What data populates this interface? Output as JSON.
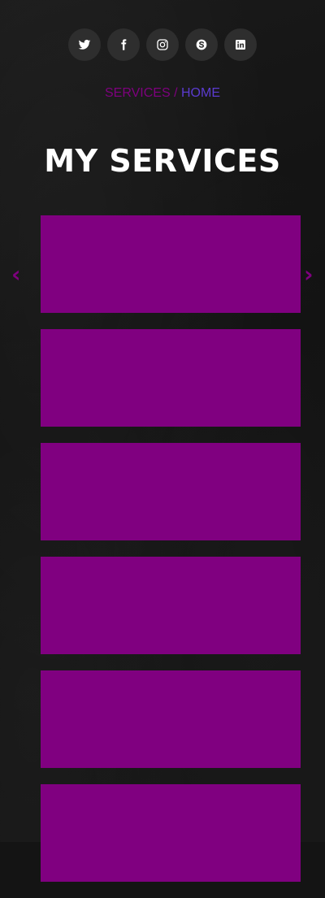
{
  "social": [
    {
      "name": "twitter-icon"
    },
    {
      "name": "facebook-icon"
    },
    {
      "name": "instagram-icon"
    },
    {
      "name": "skype-icon"
    },
    {
      "name": "linkedin-icon"
    }
  ],
  "breadcrumb": {
    "current": "SERVICES",
    "separator": "/",
    "home": "HOME"
  },
  "title": "MY SERVICES",
  "carousel": {
    "prev": "‹",
    "next": "›"
  },
  "colors": {
    "accent": "#800080",
    "link": "#5b3bd0",
    "background": "#141414",
    "social_bg": "#2e2e2e"
  }
}
